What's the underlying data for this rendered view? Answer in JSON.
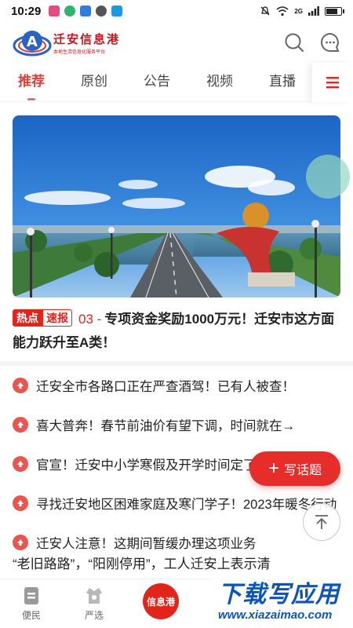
{
  "status_bar": {
    "time": "10:29",
    "network": "2G",
    "icons": [
      "app-pink-icon",
      "app-green-icon",
      "app-blue-shield-icon",
      "app-gray-icon",
      "app-blue-search-icon",
      "mute-icon",
      "wifi-icon",
      "signal-icon",
      "battery-icon"
    ]
  },
  "header": {
    "logo_title": "迁安信息港",
    "logo_subtitle": "本地生活信息化服务平台",
    "search_icon": "search-icon",
    "message_icon": "chat-bubble-icon"
  },
  "tabs": [
    {
      "label": "推荐",
      "active": true
    },
    {
      "label": "原创",
      "active": false
    },
    {
      "label": "公告",
      "active": false
    },
    {
      "label": "视频",
      "active": false
    },
    {
      "label": "直播",
      "active": false
    }
  ],
  "tab_menu_icon": "menu-lines-icon",
  "headline": {
    "tag_hot": "热点",
    "tag_fast": "速报",
    "number": "03 -",
    "text": "专项资金奖励1000万元！迁安市这方面能力跃升至A类！"
  },
  "news_list": [
    {
      "text": "迁安全市各路口正在严查酒驾！已有人被查！"
    },
    {
      "text": "喜大普奔！春节前油价有望下调，时间就在→"
    },
    {
      "text": "官宣！迁安中小学寒假及开学时间定了"
    },
    {
      "text": "寻找迁安地区困难家庭及寒门学子！2023年暖冬行动"
    },
    {
      "text": "迁安人注意！这期间暂缓办理这项业务"
    }
  ],
  "news_partial": "“老旧路路”，“阳刚停用”，工人迁安上表示清",
  "write_button": {
    "label": "写话题"
  },
  "bottom_nav": {
    "items": [
      {
        "label": "便民",
        "icon": "convenience-icon"
      },
      {
        "label": "严选",
        "icon": "shop-icon"
      }
    ],
    "center_label": "信息港"
  },
  "watermark": {
    "title": "下载写应用",
    "url": "www.xiazaimao.com"
  },
  "colors": {
    "accent": "#e1251b",
    "tab_active": "#e0403b",
    "bullet": "#e8574f",
    "watermark": "#0c55b5"
  }
}
